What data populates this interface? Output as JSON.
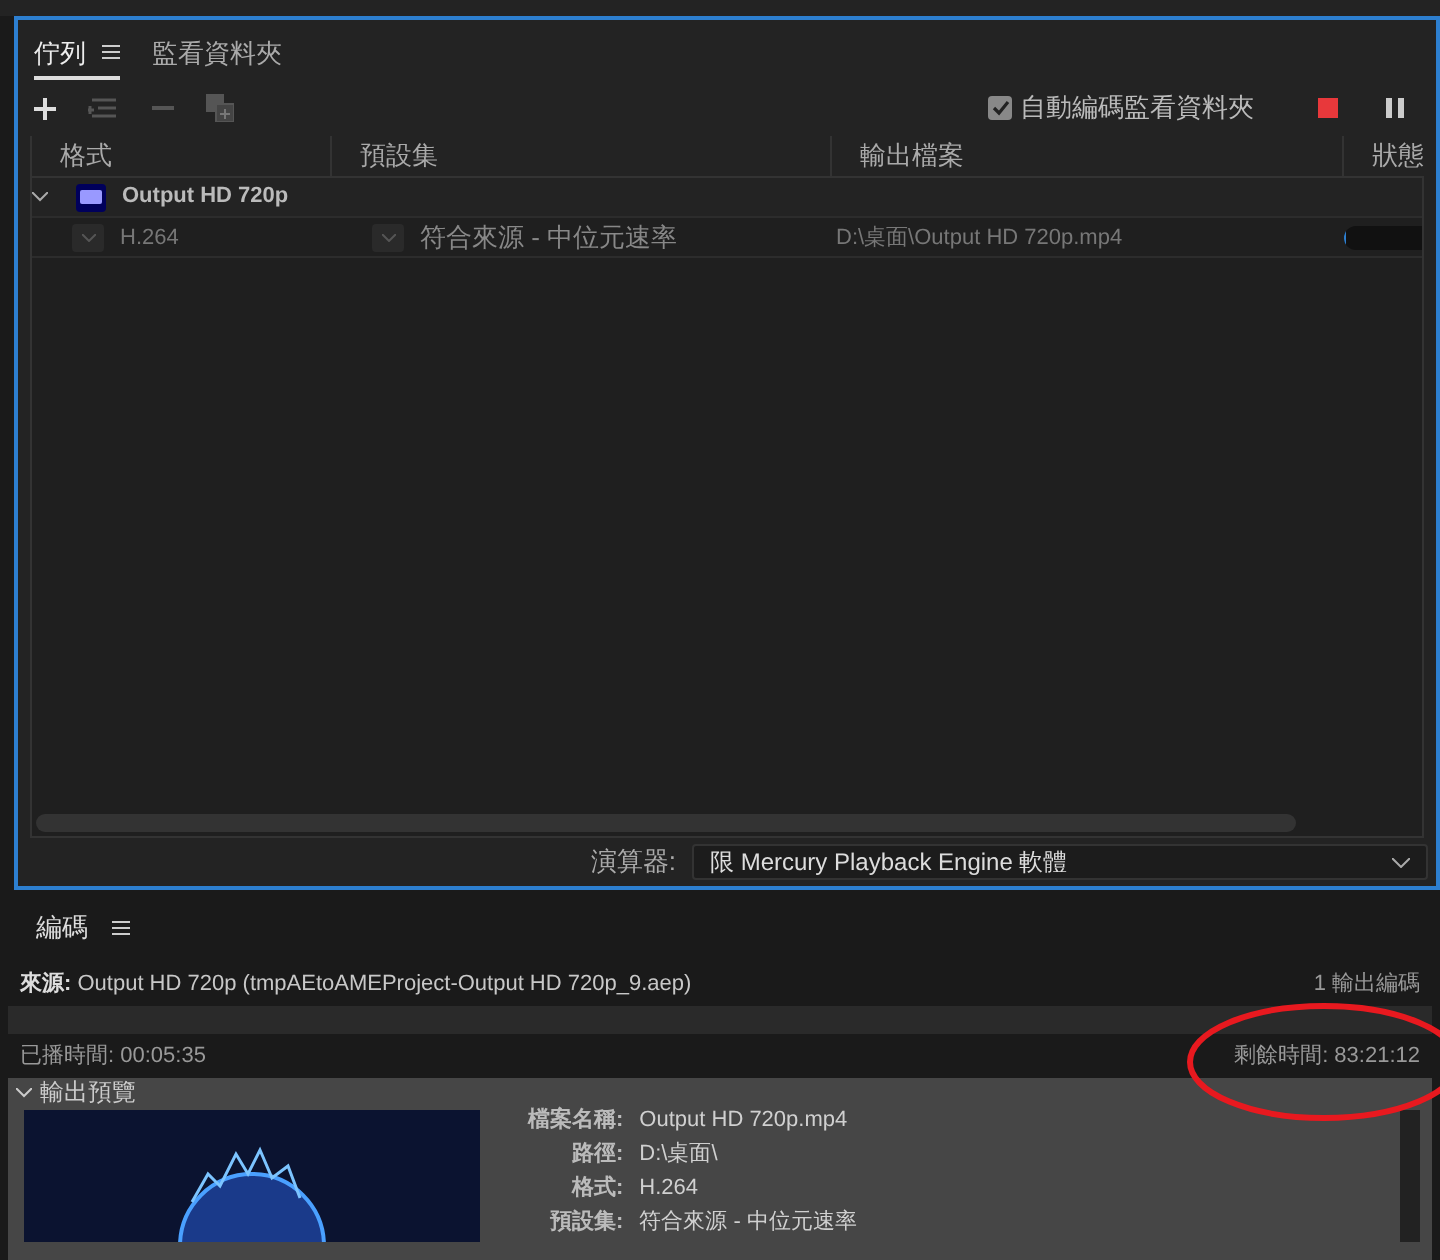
{
  "queue_panel": {
    "tabs": [
      {
        "label": "佇列",
        "selected": true
      },
      {
        "label": "監看資料夾",
        "selected": false
      }
    ],
    "auto_encode": {
      "label": "自動編碼監看資料夾",
      "checked": true
    },
    "columns": [
      "格式",
      "預設集",
      "輸出檔案",
      "狀態"
    ],
    "groups": [
      {
        "name": "Output HD 720p",
        "expanded": true,
        "items": [
          {
            "format": "H.264",
            "preset": "符合來源 - 中位元速率",
            "output": "D:\\桌面\\Output HD 720p.mp4",
            "level": 0.02
          }
        ]
      }
    ],
    "renderer": {
      "label": "演算器:",
      "value": "限 Mercury Playback Engine 軟體"
    }
  },
  "encoding_panel": {
    "title": "編碼",
    "source_label": "來源:",
    "source": "Output HD 720p (tmpAEtoAMEProject-Output HD 720p_9.aep)",
    "outputs": "1 輸出編碼",
    "progress": {
      "level": 0
    },
    "elapsed_label": "已播時間:",
    "elapsed": "00:05:35",
    "remaining_label": "剩餘時間:",
    "remaining": "83:21:12",
    "preview": {
      "title": "輸出預覽",
      "expanded": true,
      "fields": [
        {
          "label": "檔案名稱:",
          "value": "Output HD 720p.mp4"
        },
        {
          "label": "路徑:",
          "value": "D:\\桌面\\"
        },
        {
          "label": "格式:",
          "value": "H.264"
        },
        {
          "label": "預設集:",
          "value": "符合來源 - 中位元速率"
        }
      ]
    }
  }
}
